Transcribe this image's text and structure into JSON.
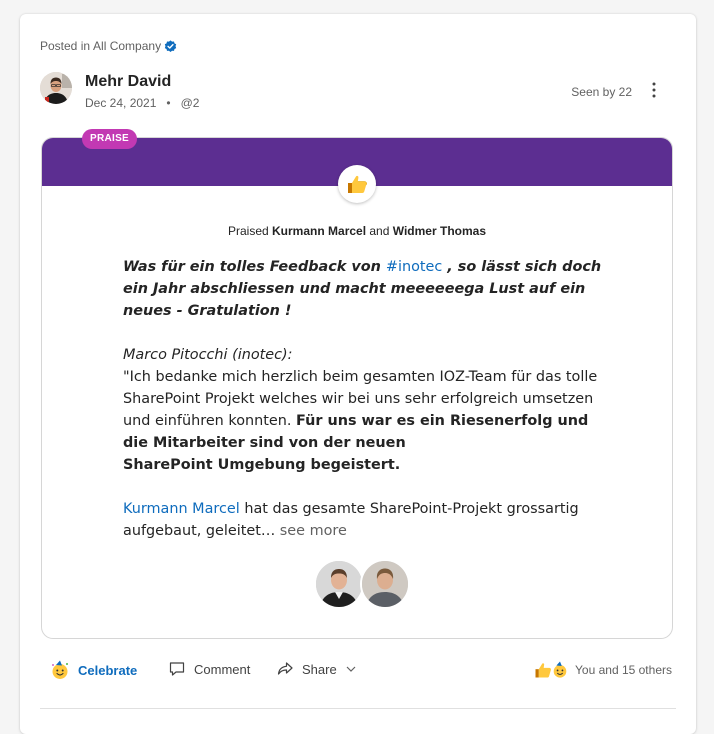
{
  "post": {
    "posted_in_prefix": "Posted in ",
    "community": "All Company",
    "author": "Mehr David",
    "date": "Dec 24, 2021",
    "separator": "•",
    "mentions": "@2",
    "seen_by": "Seen by 22"
  },
  "praise": {
    "badge": "PRAISE",
    "praised_prefix": "Praised ",
    "recipient_1": "Kurmann Marcel",
    "and_word": " and ",
    "recipient_2": "Widmer Thomas"
  },
  "message": {
    "lead_part1": "Was für ein tolles Feedback von ",
    "lead_hashtag": "#inotec",
    "lead_part2": " , so lässt sich doch ein Jahr abschliessen und macht meeeeeega Lust auf ein neues - Gratulation !",
    "quote_author": "Marco Pitocchi (inotec):",
    "quote_plain": "\"Ich bedanke mich herzlich beim gesamten IOZ-Team für das tolle SharePoint Projekt welches wir bei uns sehr erfolgreich umsetzen und einführen konnten. ",
    "quote_bold_1": "Für uns war es ein Riesenerfolg und die Mitarbeiter sind von der neuen",
    "quote_bold_2": "SharePoint Umgebung begeistert.",
    "closing_mention": "Kurmann Marcel",
    "closing_text": " hat das gesamte SharePoint-Projekt grossartig aufgebaut, geleitet…",
    "see_more": " see more"
  },
  "actions": {
    "celebrate": "Celebrate",
    "comment": "Comment",
    "share": "Share",
    "reactions_summary": "You and 15 others"
  },
  "colors": {
    "accent": "#0f6cbd",
    "praise_band": "#5c2e91",
    "praise_badge": "#c239b3"
  }
}
